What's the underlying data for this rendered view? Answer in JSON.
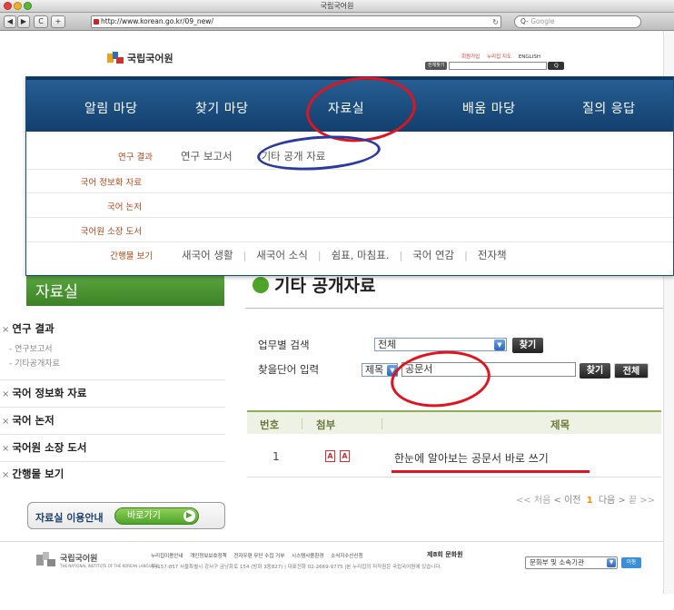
{
  "browser": {
    "window_title": "국립국어원",
    "url": "http://www.korean.go.kr/09_new/",
    "search_placeholder": "Google",
    "search_prefix": "Q-",
    "back_label": "◀",
    "forward_label": "▶",
    "reload_label": "C",
    "add_label": "+"
  },
  "header": {
    "logo_text": "국립국어원",
    "util_links": [
      "회원가입",
      "누리집 지도",
      "ENGLISH"
    ],
    "search_category": "전체찾기",
    "search_go": "Q"
  },
  "nav": {
    "items": [
      "알림 마당",
      "찾기 마당",
      "자료실",
      "배움 마당",
      "질의 응답"
    ],
    "active_index": 2
  },
  "submenu": {
    "rows": [
      {
        "label": "연구 결과",
        "items": [
          "연구 보고서",
          "기타 공개 자료"
        ]
      },
      {
        "label": "국어 정보화 자료",
        "items": []
      },
      {
        "label": "국어 논저",
        "items": []
      },
      {
        "label": "국어원 소장 도서",
        "items": []
      },
      {
        "label": "간행물 보기",
        "items": [
          "새국어 생활",
          "새국어 소식",
          "쉼표, 마침표.",
          "국어 연감",
          "전자책"
        ]
      }
    ]
  },
  "sidebar": {
    "heading": "자료실",
    "items": [
      {
        "label": "연구 결과",
        "subs": [
          "연구보고서",
          "기타공개자료"
        ]
      },
      {
        "label": "국어 정보화 자료",
        "subs": []
      },
      {
        "label": "국어 논저",
        "subs": []
      },
      {
        "label": "국어원 소장 도서",
        "subs": []
      },
      {
        "label": "간행물 보기",
        "subs": []
      }
    ],
    "bullet": "×",
    "guide_label": "자료실 이용안내",
    "guide_button": "바로가기"
  },
  "main": {
    "title": "기타 공개자료",
    "search": {
      "dept_label": "업무별 검색",
      "dept_value": "전체",
      "dept_button": "찾기",
      "keyword_label": "찾을단어 입력",
      "keyword_field": "제목",
      "keyword_value": "공문서",
      "find_button": "찾기",
      "all_button": "전체"
    },
    "table": {
      "headers": [
        "번호",
        "첨부",
        "제목"
      ],
      "rows": [
        {
          "no": "1",
          "attach": "PDF",
          "title": "한눈에 알아보는 공문서 바로 쓰기"
        }
      ]
    },
    "pager": {
      "first": "<< 처음",
      "prev": "< 이전",
      "current": "1",
      "next": "다음 >",
      "last": "끝 >>"
    }
  },
  "footer": {
    "logo_text": "국립국어원",
    "logo_sub_en": "THE NATIONAL INSTITUTE OF THE KOREAN LANGUAGE",
    "links": [
      "누리집이용안내",
      "개인정보보호정책",
      "전자우편 무단 수집 거부",
      "시스템사용환경",
      "소식지수신신청"
    ],
    "address": "우)157-857 서울특별시 강서구 금낭화로 154 (방화 3동827) | 대표전화 02-2669-9775 |본 누리집의 저작권은 국립국어원에 있습니다.",
    "rank": "제8회 문화원",
    "select_value": "문화부 및 소속기관",
    "go_label": "이동"
  },
  "colors": {
    "nav_blue": "#1f558a",
    "accent_green": "#4ea42a",
    "annotation_red": "#e0141e",
    "annotation_blue": "#2b3aa0",
    "submenu_label": "#b4451a"
  }
}
